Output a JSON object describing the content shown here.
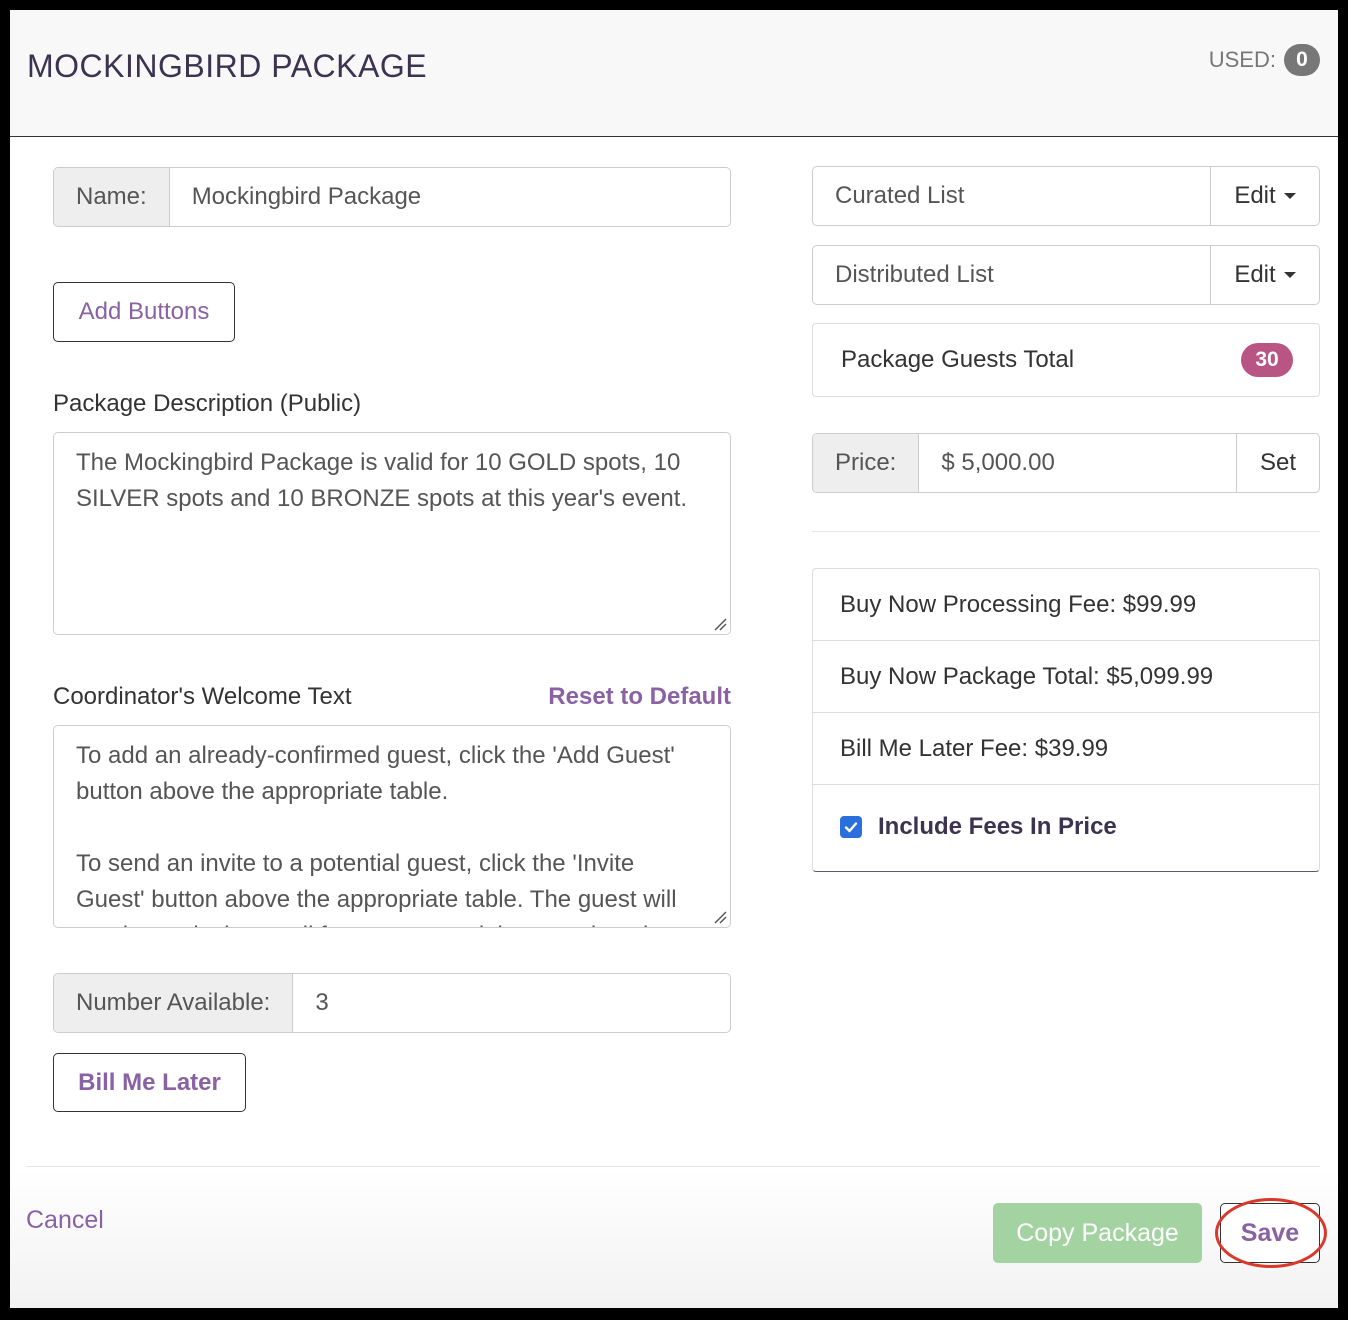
{
  "header": {
    "title": "MOCKINGBIRD PACKAGE",
    "used_label": "USED:",
    "used_count": "0"
  },
  "left": {
    "name_label": "Name:",
    "name_value": "Mockingbird Package",
    "add_buttons_label": "Add Buttons",
    "description_label": "Package Description (Public)",
    "description_text": "The Mockingbird Package is valid for 10 GOLD spots, 10 SILVER spots and 10 BRONZE spots at this year's event.",
    "welcome_label": "Coordinator's Welcome Text",
    "reset_label": "Reset to Default",
    "welcome_text": "To add an already-confirmed guest, click the 'Add Guest' button above the appropriate table.\n\nTo send an invite to a potential guest, click the 'Invite Guest' button above the appropriate table. The guest will receive an invite email from you containing a registration link.",
    "number_available_label": "Number Available:",
    "number_available_value": "3",
    "bill_me_later_label": "Bill Me Later"
  },
  "right": {
    "curated_list_label": "Curated List",
    "distributed_list_label": "Distributed List",
    "edit_label": "Edit",
    "guests_total_label": "Package Guests Total",
    "guests_total_count": "30",
    "price_label": "Price:",
    "price_value": "$ 5,000.00",
    "set_label": "Set",
    "fees": {
      "processing_fee": "Buy Now Processing Fee: $99.99",
      "package_total": "Buy Now Package Total: $5,099.99",
      "bill_me_later_fee": "Bill Me Later Fee: $39.99",
      "include_fees_label": "Include Fees In Price",
      "include_fees_checked": true
    }
  },
  "footer": {
    "cancel_label": "Cancel",
    "copy_package_label": "Copy Package",
    "save_label": "Save"
  },
  "colors": {
    "accent_purple": "#8a62a3",
    "badge_pink": "#b95584",
    "copy_button_green": "#a3d3a0",
    "annotation_red": "#d9392b"
  }
}
